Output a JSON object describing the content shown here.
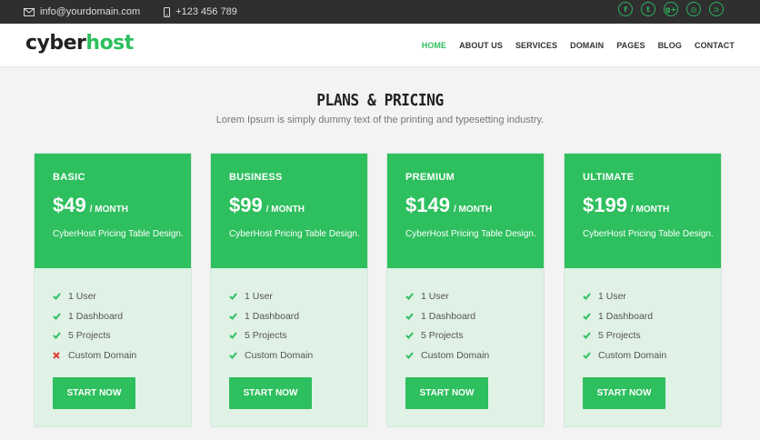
{
  "topbar": {
    "email": "info@yourdomain.com",
    "phone": "+123 456 789",
    "social": [
      "facebook-icon",
      "twitter-icon",
      "google-plus-icon",
      "dribbble-icon",
      "rss-icon"
    ],
    "social_glyphs": [
      "f",
      "t",
      "g+",
      "◎",
      "⊃"
    ]
  },
  "header": {
    "logo_part1": "cyber",
    "logo_part2": "host",
    "nav": [
      "HOME",
      "ABOUT US",
      "SERVICES",
      "DOMAIN",
      "PAGES",
      "BLOG",
      "CONTACT"
    ]
  },
  "section": {
    "title": "PLANS & PRICING",
    "subtitle": "Lorem Ipsum is simply dummy text of the printing and typesetting industry."
  },
  "colors": {
    "accent": "#2ebf5e",
    "card_body": "#e0f1e6",
    "topbar": "#2f2f2f",
    "cross": "#e53935"
  },
  "plans": [
    {
      "name": "BASIC",
      "price": "$49",
      "per": "/ MONTH",
      "desc": "CyberHost Pricing Table Design.",
      "features": [
        {
          "text": "1 User",
          "included": true
        },
        {
          "text": "1 Dashboard",
          "included": true
        },
        {
          "text": "5 Projects",
          "included": true
        },
        {
          "text": "Custom Domain",
          "included": false
        }
      ],
      "button": "START NOW"
    },
    {
      "name": "BUSINESS",
      "price": "$99",
      "per": "/ MONTH",
      "desc": "CyberHost Pricing Table Design.",
      "features": [
        {
          "text": "1 User",
          "included": true
        },
        {
          "text": "1 Dashboard",
          "included": true
        },
        {
          "text": "5 Projects",
          "included": true
        },
        {
          "text": "Custom Domain",
          "included": true
        }
      ],
      "button": "START NOW"
    },
    {
      "name": "PREMIUM",
      "price": "$149",
      "per": "/ MONTH",
      "desc": "CyberHost Pricing Table Design.",
      "features": [
        {
          "text": "1 User",
          "included": true
        },
        {
          "text": "1 Dashboard",
          "included": true
        },
        {
          "text": "5 Projects",
          "included": true
        },
        {
          "text": "Custom Domain",
          "included": true
        }
      ],
      "button": "START NOW"
    },
    {
      "name": "ULTIMATE",
      "price": "$199",
      "per": "/ MONTH",
      "desc": "CyberHost Pricing Table Design.",
      "features": [
        {
          "text": "1 User",
          "included": true
        },
        {
          "text": "1 Dashboard",
          "included": true
        },
        {
          "text": "5 Projects",
          "included": true
        },
        {
          "text": "Custom Domain",
          "included": true
        }
      ],
      "button": "START NOW"
    }
  ]
}
